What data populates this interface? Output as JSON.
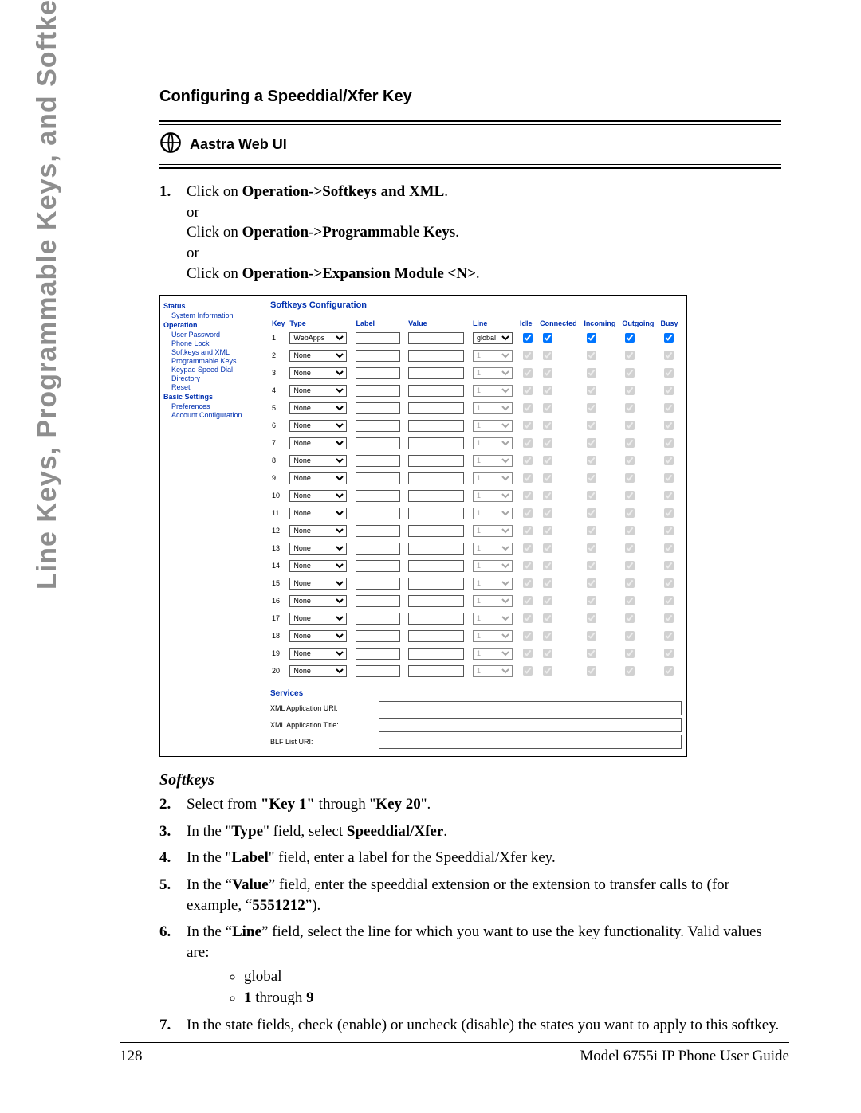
{
  "sidebar_label": "Line Keys, Programmable Keys, and Softkeys",
  "title": "Configuring a Speeddial/Xfer Key",
  "aastra": "Aastra Web UI",
  "step1": {
    "a": "Click on ",
    "a_b": "Operation->Softkeys and XML",
    "a_end": ".",
    "or": "or",
    "b": "Click on ",
    "b_b": "Operation->Programmable Keys",
    "b_end": ".",
    "c": "Click on ",
    "c_b": "Operation->Expansion Module <N>",
    "c_end": "."
  },
  "shot": {
    "nav": {
      "status": "Status",
      "status_items": [
        "System Information"
      ],
      "operation": "Operation",
      "operation_items": [
        "User Password",
        "Phone Lock",
        "Softkeys and XML",
        "Programmable Keys",
        "Keypad Speed Dial",
        "Directory",
        "Reset"
      ],
      "basic": "Basic Settings",
      "basic_items": [
        "Preferences",
        "Account Configuration"
      ]
    },
    "config_title": "Softkeys Configuration",
    "headers": {
      "key": "Key",
      "type": "Type",
      "label": "Label",
      "value": "Value",
      "line": "Line",
      "idle": "Idle",
      "connected": "Connected",
      "incoming": "Incoming",
      "outgoing": "Outgoing",
      "busy": "Busy"
    },
    "rows": [
      {
        "k": "1",
        "type": "WebApps",
        "line": "global",
        "enabled": true
      },
      {
        "k": "2",
        "type": "None",
        "line": "1"
      },
      {
        "k": "3",
        "type": "None",
        "line": "1"
      },
      {
        "k": "4",
        "type": "None",
        "line": "1"
      },
      {
        "k": "5",
        "type": "None",
        "line": "1"
      },
      {
        "k": "6",
        "type": "None",
        "line": "1"
      },
      {
        "k": "7",
        "type": "None",
        "line": "1"
      },
      {
        "k": "8",
        "type": "None",
        "line": "1"
      },
      {
        "k": "9",
        "type": "None",
        "line": "1"
      },
      {
        "k": "10",
        "type": "None",
        "line": "1"
      },
      {
        "k": "11",
        "type": "None",
        "line": "1"
      },
      {
        "k": "12",
        "type": "None",
        "line": "1"
      },
      {
        "k": "13",
        "type": "None",
        "line": "1"
      },
      {
        "k": "14",
        "type": "None",
        "line": "1"
      },
      {
        "k": "15",
        "type": "None",
        "line": "1"
      },
      {
        "k": "16",
        "type": "None",
        "line": "1"
      },
      {
        "k": "17",
        "type": "None",
        "line": "1"
      },
      {
        "k": "18",
        "type": "None",
        "line": "1"
      },
      {
        "k": "19",
        "type": "None",
        "line": "1"
      },
      {
        "k": "20",
        "type": "None",
        "line": "1"
      }
    ],
    "services_title": "Services",
    "services": [
      {
        "label": "XML Application URI:"
      },
      {
        "label": "XML Application Title:"
      },
      {
        "label": "BLF List URI:"
      }
    ]
  },
  "softkeys_heading": "Softkeys",
  "step2": {
    "a": "Select from ",
    "k1": "\"Key 1\"",
    "mid": " through \"",
    "k20": "Key 20",
    "end": "\"."
  },
  "step3": {
    "a": "In the \"",
    "type": "Type",
    "b": "\" field, select ",
    "sx": "Speeddial/Xfer",
    "end": "."
  },
  "step4": {
    "a": "In the \"",
    "lbl": "Label",
    "b": "\" field, enter a label for the Speeddial/Xfer key."
  },
  "step5": {
    "a": "In the “",
    "val": "Value",
    "b": "” field, enter the speeddial extension or the extension to transfer calls to (for example, “",
    "num": "5551212",
    "end": "”)."
  },
  "step6": {
    "a": "In the “",
    "line": "Line",
    "b": "” field, select the line for which you want to use the key functionality. Valid values are:"
  },
  "sub1": "global",
  "sub2a": "1",
  "sub2b": " through ",
  "sub2c": "9",
  "step7": "In the state fields, check (enable) or uncheck (disable) the states you want to apply to this softkey.",
  "footer": {
    "page": "128",
    "guide": "Model 6755i IP Phone User Guide"
  }
}
